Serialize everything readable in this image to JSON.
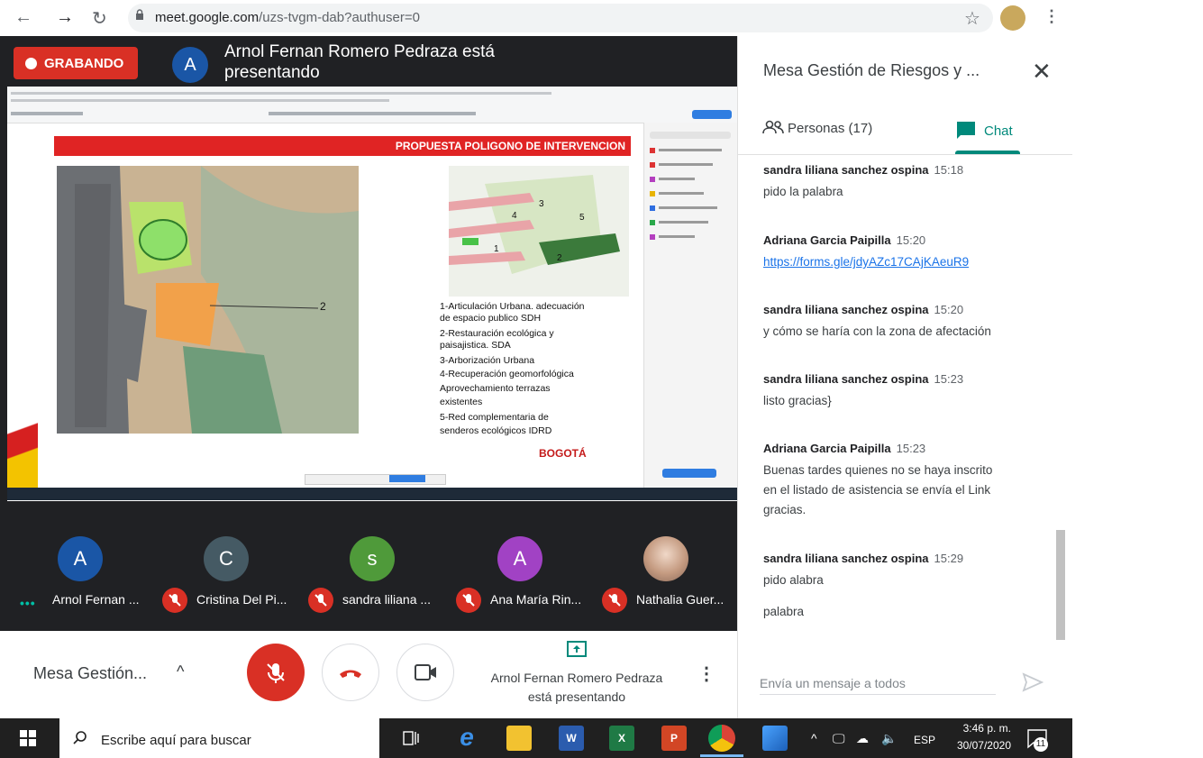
{
  "browser": {
    "url_host": "meet.google.com",
    "url_path": "/uzs-tvgm-dab?authuser=0"
  },
  "recording": {
    "label": "GRABANDO"
  },
  "presenter": {
    "avatar_letter": "A",
    "text": "Arnol Fernan Romero Pedraza está presentando"
  },
  "slide": {
    "title": "PROPUESTA  POLIGONO DE INTERVENCION",
    "legend": [
      "1-Articulación  Urbana.  adecuación",
      "de espacio publico SDH",
      "2-Restauración ecológica y",
      " paisajistica.  SDA",
      "3-Arborización Urbana",
      "4-Recuperación geomorfológica",
      "Aprovechamiento               terrazas",
      "existentes",
      "5-Red         complementaria         de",
      "senderos ecológicos IDRD"
    ],
    "logo": "BOGOTÁ",
    "map_label": "2"
  },
  "participants": [
    {
      "letter": "A",
      "name": "Arnol Fernan ...",
      "color": "#1a56a6",
      "mic": "speaking"
    },
    {
      "letter": "C",
      "name": "Cristina Del Pi...",
      "color": "#455a64",
      "mic": "muted"
    },
    {
      "letter": "s",
      "name": "sandra liliana ...",
      "color": "#4f9a3a",
      "mic": "muted"
    },
    {
      "letter": "A",
      "name": "Ana María Rin...",
      "color": "#a142c4",
      "mic": "muted"
    },
    {
      "letter": "",
      "name": "Nathalia Guer...",
      "color": "#d9b8a8",
      "mic": "muted"
    }
  ],
  "controls": {
    "meeting_name": "Mesa Gestión...",
    "present_line1": "Arnol Fernan Romero Pedraza",
    "present_line2": "está presentando"
  },
  "panel": {
    "title": "Mesa Gestión de Riesgos y ...",
    "tab_people": "Personas (17)",
    "tab_chat": "Chat",
    "input_placeholder": "Envía un mensaje a todos"
  },
  "chat": [
    {
      "sender": "sandra liliana sanchez ospina",
      "time": "15:18",
      "lines": [
        "pido la palabra"
      ]
    },
    {
      "sender": "Adriana Garcia Paipilla",
      "time": "15:20",
      "link": "https://forms.gle/jdyAZc17CAjKAeuR9"
    },
    {
      "sender": "sandra liliana sanchez ospina",
      "time": "15:20",
      "lines": [
        "y cómo se haría con la zona de afectación"
      ]
    },
    {
      "sender": "sandra liliana sanchez ospina",
      "time": "15:23",
      "lines": [
        "listo gracias}"
      ]
    },
    {
      "sender": "Adriana Garcia Paipilla",
      "time": "15:23",
      "lines": [
        "Buenas tardes quienes no se haya inscrito",
        "en el  listado de asistencia se envía el Link",
        "gracias."
      ]
    },
    {
      "sender": "sandra liliana sanchez ospina",
      "time": "15:29",
      "lines": [
        "pido alabra"
      ]
    }
  ],
  "chat_extra": "palabra",
  "taskbar": {
    "search": "Escribe aquí para buscar",
    "lang": "ESP",
    "time": "3:46 p. m.",
    "date": "30/07/2020",
    "notifications": "11"
  }
}
